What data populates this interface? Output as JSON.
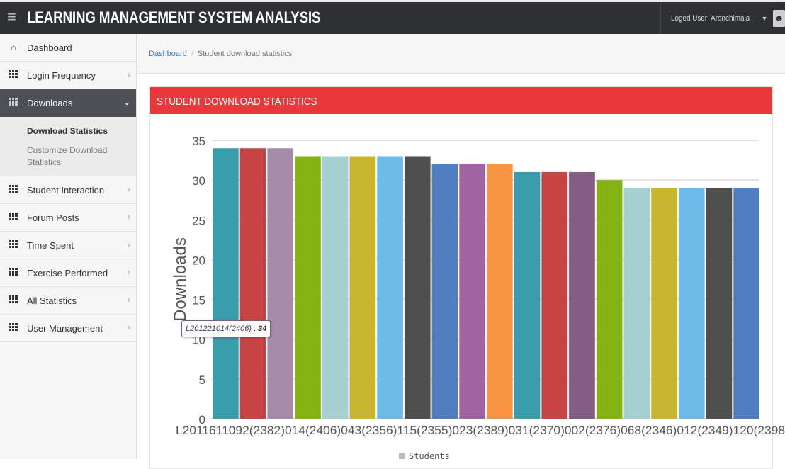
{
  "header": {
    "title": "LEARNING MANAGEMENT SYSTEM ANALYSIS",
    "user_label": "Loged User: Aronchimala"
  },
  "sidebar": {
    "items": [
      {
        "label": "Dashboard",
        "icon": "home-icon"
      },
      {
        "label": "Login Frequency",
        "icon": "grid-icon"
      },
      {
        "label": "Downloads",
        "icon": "grid-icon",
        "active": true,
        "subitems": [
          "Download Statistics",
          "Customize Download Statistics"
        ]
      },
      {
        "label": "Student Interaction",
        "icon": "grid-icon"
      },
      {
        "label": "Forum Posts",
        "icon": "grid-icon"
      },
      {
        "label": "Time Spent",
        "icon": "grid-icon"
      },
      {
        "label": "Exercise Performed",
        "icon": "grid-icon"
      },
      {
        "label": "All Statistics",
        "icon": "grid-icon"
      },
      {
        "label": "User Management",
        "icon": "grid-icon"
      }
    ]
  },
  "breadcrumb": {
    "home": "Dashboard",
    "current": "Student download statistics"
  },
  "panel": {
    "title": "STUDENT DOWNLOAD STATISTICS"
  },
  "tooltip": {
    "key": "L201221014(2406)",
    "sep": " : ",
    "value": "34"
  },
  "chart_data": {
    "type": "bar",
    "ylabel": "Downloads",
    "ylim": [
      0,
      35
    ],
    "yticks": [
      0,
      5,
      10,
      15,
      20,
      25,
      30,
      35
    ],
    "grid": true,
    "legend": "Students",
    "legend_position": "bottom",
    "values": [
      34,
      34,
      34,
      33,
      33,
      33,
      33,
      33,
      32,
      32,
      32,
      31,
      31,
      31,
      30,
      29,
      29,
      29,
      29,
      29
    ],
    "colors": [
      "#3a9dab",
      "#c84444",
      "#a68ca8",
      "#84b414",
      "#a7d0d0",
      "#c8b630",
      "#6dbbe8",
      "#4f4f4d",
      "#4f7fc1",
      "#a064a3",
      "#f79545",
      "#3a9dab",
      "#c84444",
      "#835d84",
      "#84b414",
      "#a7d0d0",
      "#c8b630",
      "#6dbbe8",
      "#4f4f4d",
      "#4f7fc1"
    ],
    "xlabel_visible_text": "L2011611092(2382)014(2406)043(2356)115(2355)023(2389)031(2370)002(2376)068(2346)012(2349)120(2398"
  }
}
